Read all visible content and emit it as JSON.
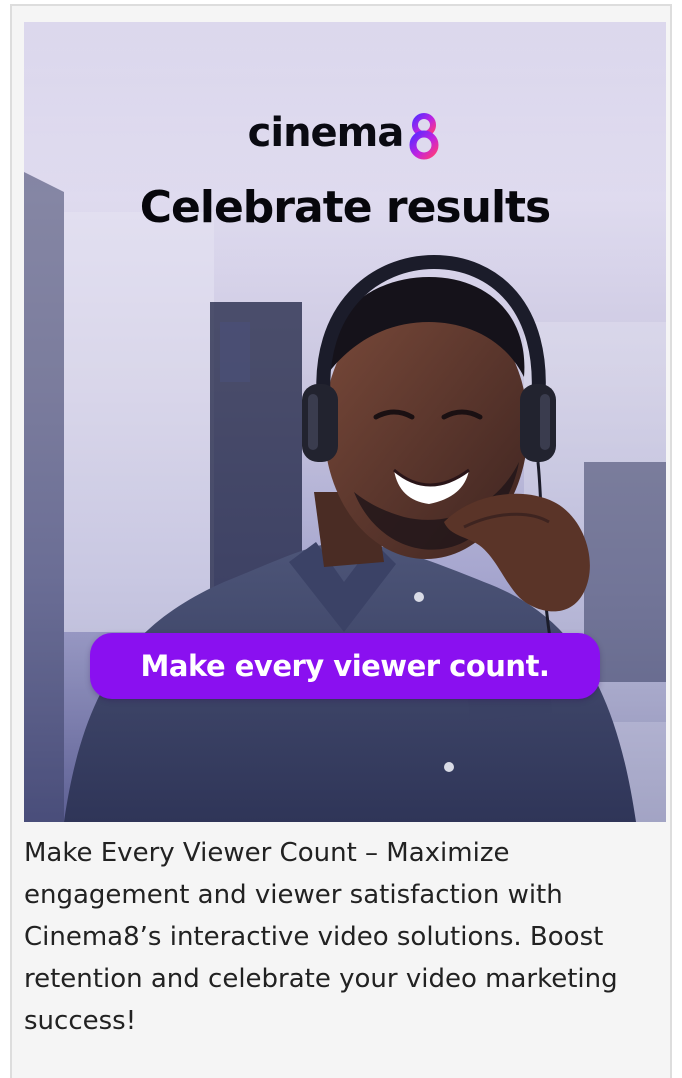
{
  "banner": {
    "brand": {
      "wordmark": "cinema",
      "mark_icon": "figure-eight-logo-icon",
      "mark_colors": [
        "#5b2bff",
        "#c024e0",
        "#ff3a7a"
      ]
    },
    "headline": "Celebrate results",
    "cta": "Make every viewer count.",
    "cta_color": "#8a10f0",
    "photo_subject": "smiling-man-with-headset-image"
  },
  "caption": "Make Every Viewer Count – Maximize engagement and viewer satisfaction with Cinema8’s interactive video solutions. Boost retention and celebrate your video marketing success!"
}
